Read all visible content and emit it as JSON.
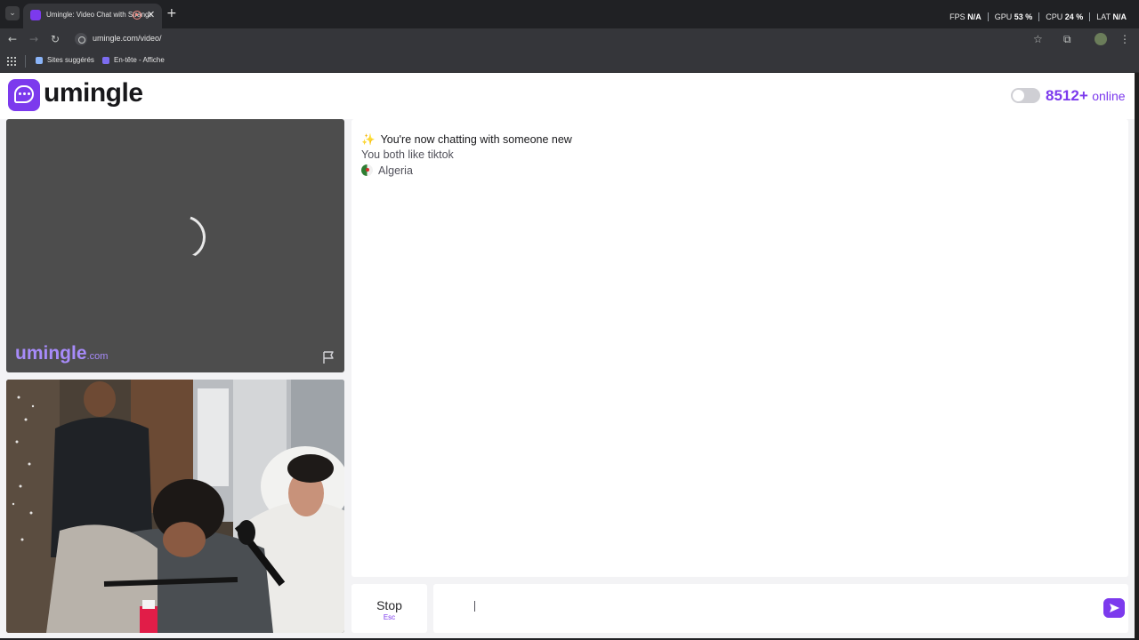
{
  "browser": {
    "tab_title": "Umingle: Video Chat with Strangers",
    "url": "umingle.com/video/",
    "bookmarks": [
      {
        "label": "Sites suggérés"
      },
      {
        "label": "En-tête - Affiche"
      }
    ],
    "perf": {
      "fps_label": "FPS",
      "fps_value": "N/A",
      "gpu_label": "GPU",
      "gpu_value": "53 %",
      "cpu_label": "CPU",
      "cpu_value": "24 %",
      "lat_label": "LAT",
      "lat_value": "N/A"
    }
  },
  "header": {
    "logo_text": "umingle",
    "online_count": "8512+",
    "online_label": "online"
  },
  "remote_video": {
    "watermark": "umingle",
    "watermark_domain": ".com"
  },
  "chat": {
    "messages": [
      {
        "text": "You're now chatting with someone new"
      },
      {
        "text": "You both like tiktok"
      },
      {
        "text": "Algeria"
      }
    ]
  },
  "controls": {
    "stop_label": "Stop",
    "stop_key": "Esc",
    "input_placeholder": ""
  },
  "colors": {
    "accent": "#7c3aed",
    "page_bg": "#f3f3f5",
    "panel_bg": "#ffffff"
  },
  "icons": [
    "tab-list-icon",
    "close-icon",
    "plus-icon",
    "back-icon",
    "forward-icon",
    "reload-icon",
    "star-icon",
    "extensions-icon",
    "menu-icon",
    "apps-icon",
    "logo-icon",
    "spinner-icon",
    "flag-report-icon",
    "sparkles-icon",
    "algeria-flag-icon",
    "send-icon"
  ]
}
